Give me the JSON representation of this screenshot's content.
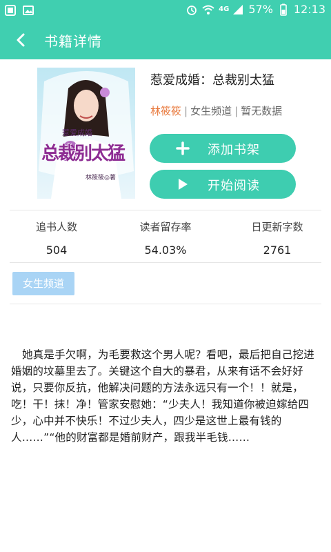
{
  "status_bar": {
    "battery": "57%",
    "time": "12:13",
    "network": "4G",
    "accent_color": "#40cfb0"
  },
  "header": {
    "title": "书籍详情",
    "back_icon": "chevron-left-icon"
  },
  "book": {
    "title": "惹爱成婚：总裁别太猛",
    "author": "林筱筱",
    "channel": "女生频道",
    "status": "暂无数据",
    "cover": {
      "top_text": "惹爱成婚",
      "main_text": "总裁别太猛",
      "author_text": "林筱筱◎著"
    }
  },
  "actions": {
    "add_shelf_label": "添加书架",
    "start_read_label": "开始阅读"
  },
  "stats": [
    {
      "label": "追书人数",
      "value": "504"
    },
    {
      "label": "读者留存率",
      "value": "54.03%"
    },
    {
      "label": "日更新字数",
      "value": "2761"
    }
  ],
  "tag": "女生频道",
  "description": "她真是手欠啊，为毛要救这个男人呢？看吧，最后把自己挖进婚姻的坟墓里去了。关键这个自大的暴君，从来有话不会好好说，只要你反抗，他解决问题的方法永远只有一个！！就是，吃！干！抹！净！管家安慰她：“少夫人！我知道你被迫嫁给四少，心中并不快乐！不过少夫人，四少是这世上最有钱的人……”“他的财富都是婚前财产，跟我半毛钱……"
}
